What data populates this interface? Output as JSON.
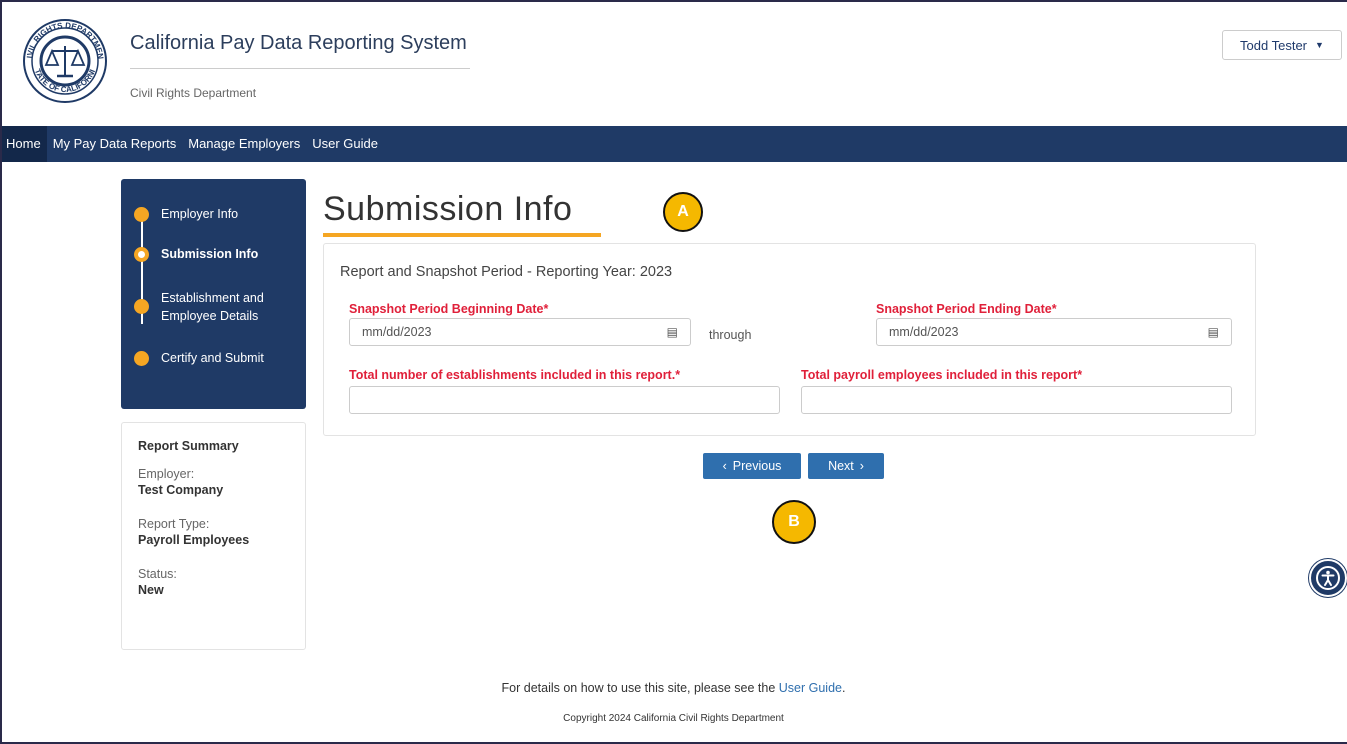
{
  "header": {
    "app_title": "California Pay Data Reporting System",
    "department": "Civil Rights Department",
    "seal_text_top": "CIVIL RIGHTS DEPARTMENT",
    "seal_text_bottom": "STATE OF CALIFORNIA",
    "user_name": "Todd Tester"
  },
  "nav": {
    "items": [
      "Home",
      "My Pay Data Reports",
      "Manage Employers",
      "User Guide"
    ],
    "active": "Home"
  },
  "steps": [
    {
      "label": "Employer Info",
      "state": "done"
    },
    {
      "label": "Submission Info",
      "state": "current"
    },
    {
      "label": "Establishment and Employee Details",
      "state": "todo"
    },
    {
      "label": "Certify and Submit",
      "state": "todo"
    }
  ],
  "summary": {
    "heading": "Report Summary",
    "employer_label": "Employer:",
    "employer_value": "Test Company",
    "type_label": "Report Type:",
    "type_value": "Payroll Employees",
    "status_label": "Status:",
    "status_value": "New"
  },
  "main": {
    "page_title": "Submission Info",
    "card_title": "Report and Snapshot Period - Reporting Year: 2023",
    "begin_label": "Snapshot Period Beginning Date*",
    "begin_value": "mm/dd/2023",
    "through": "through",
    "end_label": "Snapshot Period Ending Date*",
    "end_value": "mm/dd/2023",
    "establishments_label": "Total number of establishments included in this report.*",
    "establishments_value": "",
    "employees_label": "Total payroll employees included in this report*",
    "employees_value": "",
    "previous_label": "Previous",
    "next_label": "Next"
  },
  "markers": {
    "a": "A",
    "b": "B"
  },
  "footer": {
    "help_prefix": "For details on how to use this site, please see the ",
    "help_link": "User Guide",
    "help_suffix": ".",
    "copyright": "Copyright 2024 California Civil Rights Department"
  },
  "colors": {
    "navy": "#1f3a66",
    "accent": "#f5a623",
    "required": "#e0203a",
    "button": "#2f6fae"
  }
}
